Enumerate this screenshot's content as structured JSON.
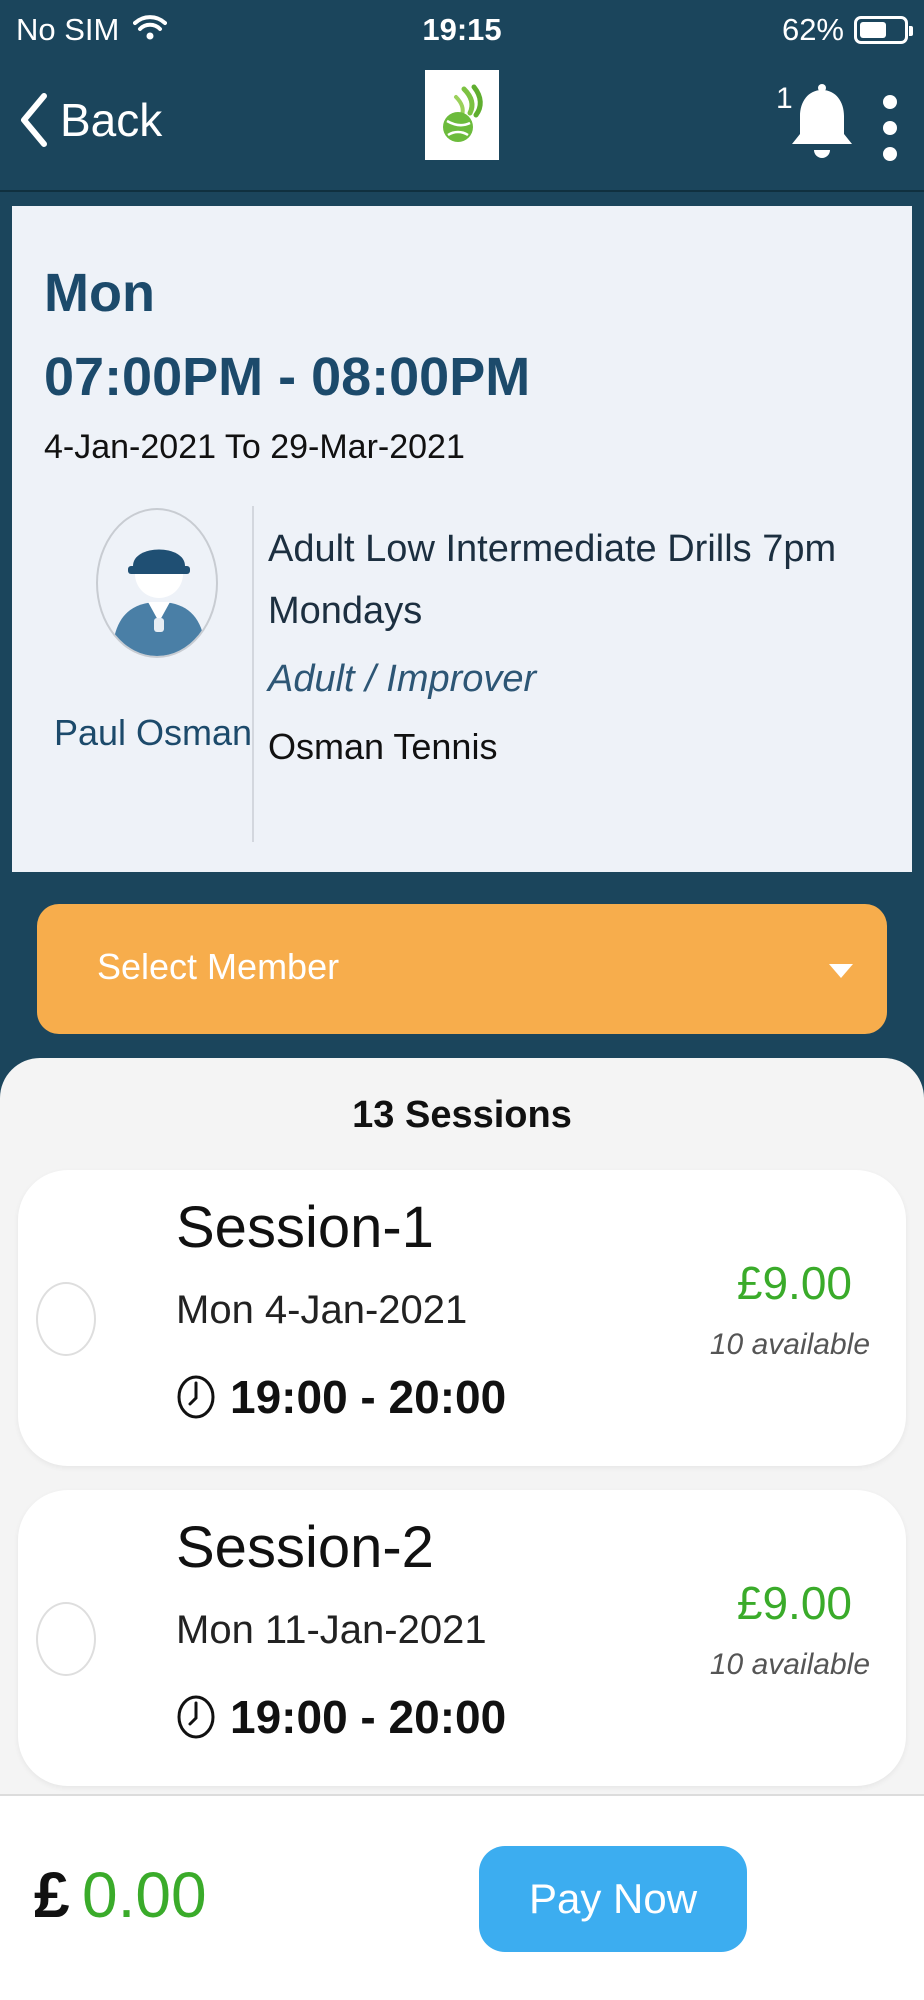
{
  "status_bar": {
    "carrier": "No SIM",
    "time": "19:15",
    "battery": "62%"
  },
  "nav": {
    "back_label": "Back",
    "notification_count": "1",
    "logo_icon": "tennis-ball-logo-icon"
  },
  "class": {
    "day": "Mon",
    "time": "07:00PM - 08:00PM",
    "dates": "4-Jan-2021 To 29-Mar-2021",
    "coach": "Paul Osman",
    "title": "Adult Low Intermediate Drills 7pm Mondays",
    "level": "Adult / Improver",
    "club": "Osman Tennis"
  },
  "select_member": {
    "label": "Select Member"
  },
  "sessions": {
    "count_label": "13 Sessions",
    "items": [
      {
        "title": "Session-1",
        "date": "Mon 4-Jan-2021",
        "time": "19:00 - 20:00",
        "price": "£9.00",
        "availability": "10 available"
      },
      {
        "title": "Session-2",
        "date": "Mon 11-Jan-2021",
        "time": "19:00 - 20:00",
        "price": "£9.00",
        "availability": "10 available"
      }
    ]
  },
  "footer": {
    "currency": "£",
    "total": "0.00",
    "pay_label": "Pay Now"
  },
  "colors": {
    "header_bg": "#1b455c",
    "accent_orange": "#f7ad4c",
    "price_green": "#3aab2a",
    "pay_blue": "#3cadf0"
  }
}
